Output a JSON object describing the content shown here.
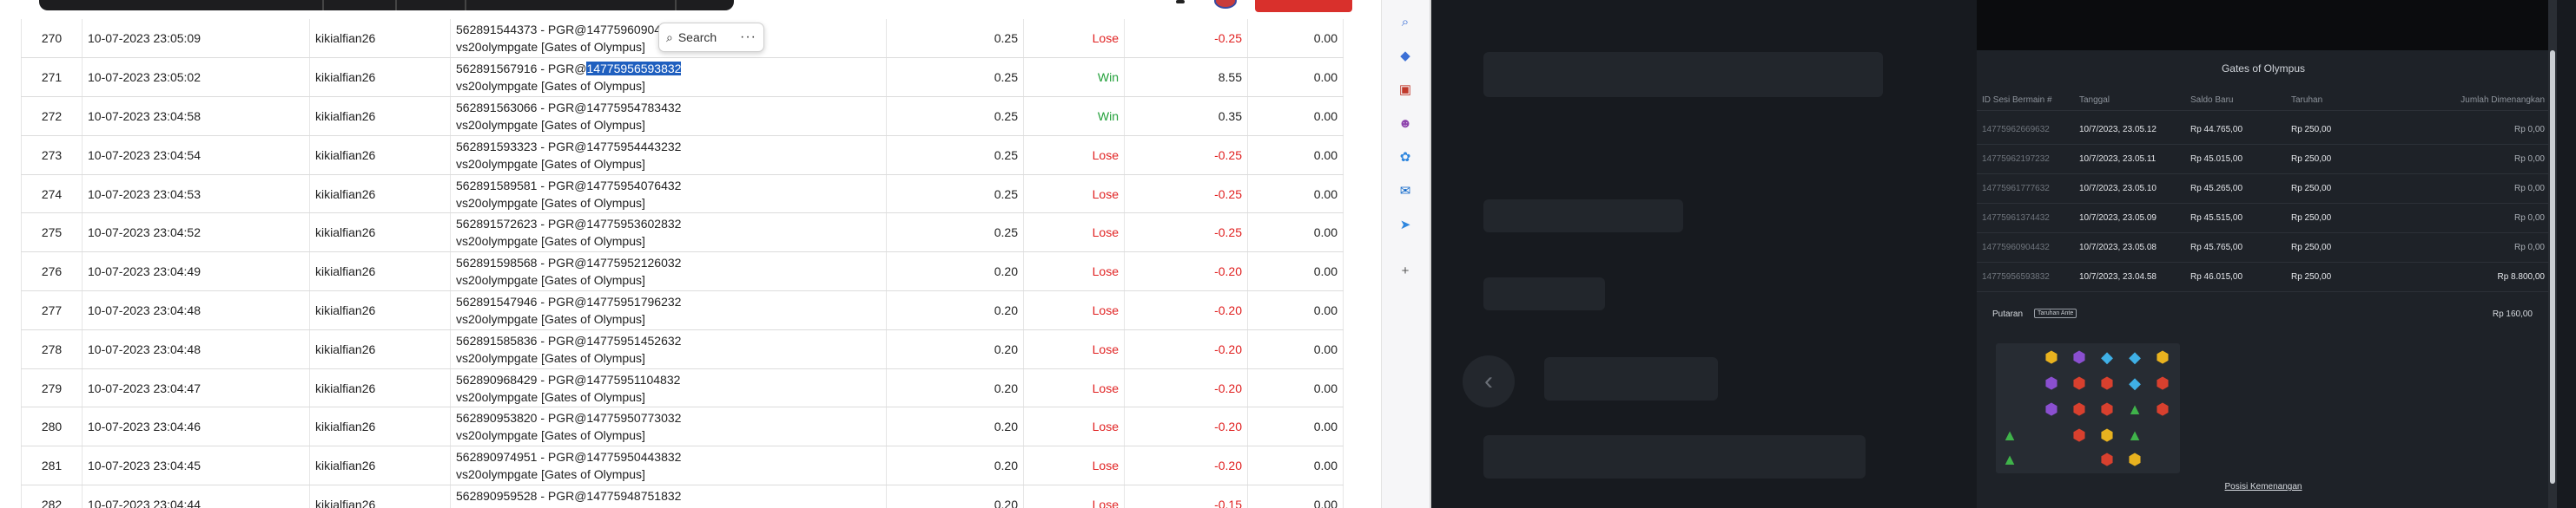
{
  "search_popover": {
    "label": "Search",
    "more": "···"
  },
  "table": {
    "rows": [
      {
        "no": "270",
        "date": "10-07-2023 23:05:09",
        "user": "kikialfian26",
        "desc1_pre": "562891544373 - PGR@14775960904",
        "desc1_hl": "",
        "desc2": "vs20olympgate [Gates of Olympus]",
        "bet": "0.25",
        "result": "Lose",
        "payout": "-0.25",
        "bonus": "0.00"
      },
      {
        "no": "271",
        "date": "10-07-2023 23:05:02",
        "user": "kikialfian26",
        "desc1_pre": "562891567916 - PGR@",
        "desc1_hl": "14775956593832",
        "desc2": "vs20olympgate [Gates of Olympus]",
        "bet": "0.25",
        "result": "Win",
        "payout": "8.55",
        "bonus": "0.00"
      },
      {
        "no": "272",
        "date": "10-07-2023 23:04:58",
        "user": "kikialfian26",
        "desc1_pre": "562891563066 - PGR@14775954783432",
        "desc1_hl": "",
        "desc2": "vs20olympgate [Gates of Olympus]",
        "bet": "0.25",
        "result": "Win",
        "payout": "0.35",
        "bonus": "0.00"
      },
      {
        "no": "273",
        "date": "10-07-2023 23:04:54",
        "user": "kikialfian26",
        "desc1_pre": "562891593323 - PGR@14775954443232",
        "desc1_hl": "",
        "desc2": "vs20olympgate [Gates of Olympus]",
        "bet": "0.25",
        "result": "Lose",
        "payout": "-0.25",
        "bonus": "0.00"
      },
      {
        "no": "274",
        "date": "10-07-2023 23:04:53",
        "user": "kikialfian26",
        "desc1_pre": "562891589581 - PGR@14775954076432",
        "desc1_hl": "",
        "desc2": "vs20olympgate [Gates of Olympus]",
        "bet": "0.25",
        "result": "Lose",
        "payout": "-0.25",
        "bonus": "0.00"
      },
      {
        "no": "275",
        "date": "10-07-2023 23:04:52",
        "user": "kikialfian26",
        "desc1_pre": "562891572623 - PGR@14775953602832",
        "desc1_hl": "",
        "desc2": "vs20olympgate [Gates of Olympus]",
        "bet": "0.25",
        "result": "Lose",
        "payout": "-0.25",
        "bonus": "0.00"
      },
      {
        "no": "276",
        "date": "10-07-2023 23:04:49",
        "user": "kikialfian26",
        "desc1_pre": "562891598568 - PGR@14775952126032",
        "desc1_hl": "",
        "desc2": "vs20olympgate [Gates of Olympus]",
        "bet": "0.20",
        "result": "Lose",
        "payout": "-0.20",
        "bonus": "0.00"
      },
      {
        "no": "277",
        "date": "10-07-2023 23:04:48",
        "user": "kikialfian26",
        "desc1_pre": "562891547946 - PGR@14775951796232",
        "desc1_hl": "",
        "desc2": "vs20olympgate [Gates of Olympus]",
        "bet": "0.20",
        "result": "Lose",
        "payout": "-0.20",
        "bonus": "0.00"
      },
      {
        "no": "278",
        "date": "10-07-2023 23:04:48",
        "user": "kikialfian26",
        "desc1_pre": "562891585836 - PGR@14775951452632",
        "desc1_hl": "",
        "desc2": "vs20olympgate [Gates of Olympus]",
        "bet": "0.20",
        "result": "Lose",
        "payout": "-0.20",
        "bonus": "0.00"
      },
      {
        "no": "279",
        "date": "10-07-2023 23:04:47",
        "user": "kikialfian26",
        "desc1_pre": "562890968429 - PGR@14775951104832",
        "desc1_hl": "",
        "desc2": "vs20olympgate [Gates of Olympus]",
        "bet": "0.20",
        "result": "Lose",
        "payout": "-0.20",
        "bonus": "0.00"
      },
      {
        "no": "280",
        "date": "10-07-2023 23:04:46",
        "user": "kikialfian26",
        "desc1_pre": "562890953820 - PGR@14775950773032",
        "desc1_hl": "",
        "desc2": "vs20olympgate [Gates of Olympus]",
        "bet": "0.20",
        "result": "Lose",
        "payout": "-0.20",
        "bonus": "0.00"
      },
      {
        "no": "281",
        "date": "10-07-2023 23:04:45",
        "user": "kikialfian26",
        "desc1_pre": "562890974951 - PGR@14775950443832",
        "desc1_hl": "",
        "desc2": "vs20olympgate [Gates of Olympus]",
        "bet": "0.20",
        "result": "Lose",
        "payout": "-0.20",
        "bonus": "0.00"
      },
      {
        "no": "282",
        "date": "10-07-2023 23:04:44",
        "user": "kikialfian26",
        "desc1_pre": "562890959528 - PGR@14775948751832",
        "desc1_hl": "",
        "desc2": "vs20olympgate [Gates of Olympus]",
        "bet": "0.20",
        "result": "Lose",
        "payout": "-0.15",
        "bonus": "0.00"
      }
    ]
  },
  "sidebar": {
    "icons": [
      {
        "name": "search-icon",
        "glyph": "⌕",
        "color": "#3b6fd6"
      },
      {
        "name": "tag-icon",
        "glyph": "◆",
        "color": "#3b6fd6"
      },
      {
        "name": "toolbox-icon",
        "glyph": "▣",
        "color": "#c0392b"
      },
      {
        "name": "user-gear-icon",
        "glyph": "☻",
        "color": "#8e44ad"
      },
      {
        "name": "copilot-icon",
        "glyph": "✿",
        "color": "#2e86de"
      },
      {
        "name": "outlook-icon",
        "glyph": "✉",
        "color": "#0a64c8"
      },
      {
        "name": "send-icon",
        "glyph": "➤",
        "color": "#2e86de"
      },
      {
        "name": "add-icon",
        "glyph": "+",
        "color": "#555555"
      }
    ]
  },
  "game": {
    "title": "Gates of Olympus",
    "headers": [
      "ID Sesi Bermain #",
      "Tanggal",
      "Saldo Baru",
      "Taruhan",
      "Jumlah Dimenangkan"
    ],
    "rows": [
      {
        "id": "14775962669632",
        "date": "10/7/2023, 23.05.12",
        "balance": "Rp 44.765,00",
        "bet": "Rp 250,00",
        "won": "Rp 0,00"
      },
      {
        "id": "14775962197232",
        "date": "10/7/2023, 23.05.11",
        "balance": "Rp 45.015,00",
        "bet": "Rp 250,00",
        "won": "Rp 0,00"
      },
      {
        "id": "14775961777632",
        "date": "10/7/2023, 23.05.10",
        "balance": "Rp 45.265,00",
        "bet": "Rp 250,00",
        "won": "Rp 0,00"
      },
      {
        "id": "14775961374432",
        "date": "10/7/2023, 23.05.09",
        "balance": "Rp 45.515,00",
        "bet": "Rp 250,00",
        "won": "Rp 0,00"
      },
      {
        "id": "14775960904432",
        "date": "10/7/2023, 23.05.08",
        "balance": "Rp 45.765,00",
        "bet": "Rp 250,00",
        "won": "Rp 0,00"
      },
      {
        "id": "14775956593832",
        "date": "10/7/2023, 23.04.58",
        "balance": "Rp 46.015,00",
        "bet": "Rp 250,00",
        "won": "Rp 8.800,00"
      }
    ],
    "round_label": "Putaran",
    "round_badge": "Taruhan Ante",
    "round_value": "Rp 160,00",
    "win_position_link": "Posisi Kemenangan"
  },
  "colors": {
    "lose": "#e02020",
    "win": "#22a03a",
    "highlight": "#1f5fbf",
    "dark_bg": "#171a1f"
  }
}
